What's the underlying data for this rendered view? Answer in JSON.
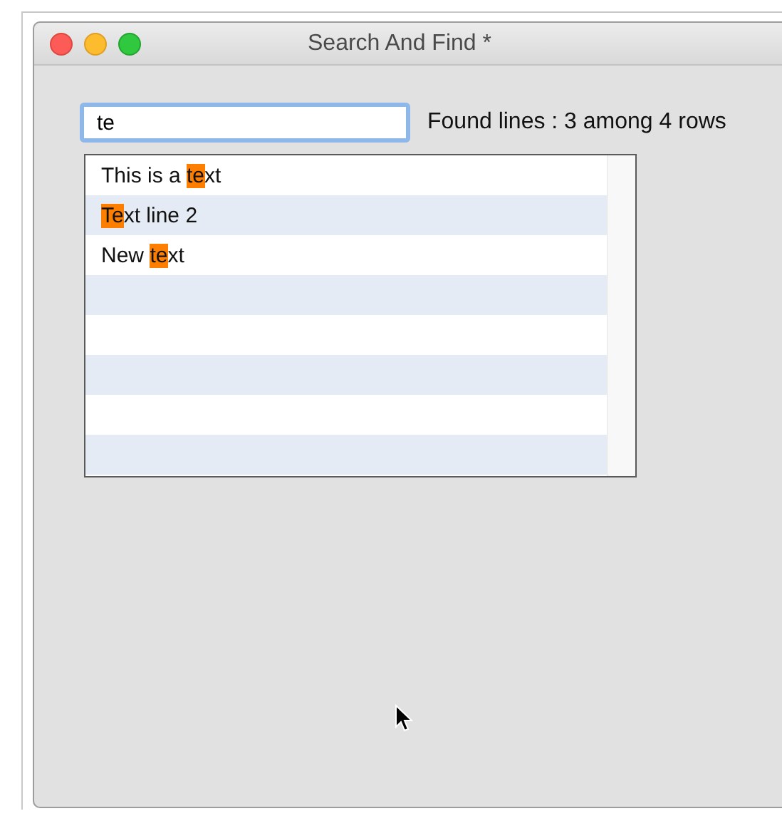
{
  "window": {
    "title": "Search And Find *"
  },
  "search": {
    "value": "te"
  },
  "result_label": "Found lines : 3 among 4 rows",
  "rows": [
    {
      "segments": [
        {
          "text": "This is a ",
          "highlighted": false
        },
        {
          "text": "te",
          "highlighted": true
        },
        {
          "text": "xt",
          "highlighted": false
        }
      ]
    },
    {
      "segments": [
        {
          "text": "Te",
          "highlighted": true
        },
        {
          "text": "xt line 2",
          "highlighted": false
        }
      ]
    },
    {
      "segments": [
        {
          "text": "New ",
          "highlighted": false
        },
        {
          "text": "te",
          "highlighted": true
        },
        {
          "text": "xt",
          "highlighted": false
        }
      ]
    },
    {
      "segments": []
    },
    {
      "segments": []
    },
    {
      "segments": []
    },
    {
      "segments": []
    },
    {
      "segments": []
    }
  ]
}
